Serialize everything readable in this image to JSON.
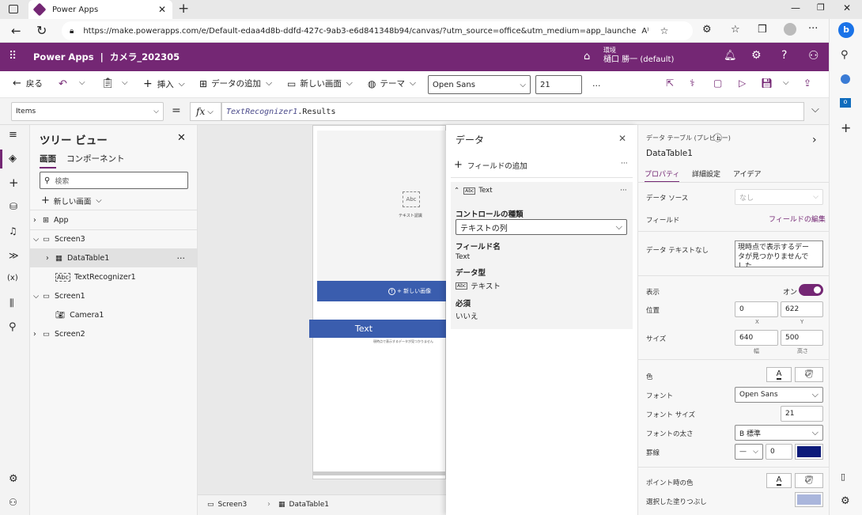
{
  "browser": {
    "tab_title": "Power Apps",
    "url": "https://make.powerapps.com/e/Default-edaa4d8b-ddfd-427c-9ab3-e6d841348b94/canvas/?utm_source=office&utm_medium=app_launcher&utm_...",
    "accent": "#1a73e8"
  },
  "header": {
    "product": "Power Apps",
    "separator": "|",
    "app_name": "カメラ_202305",
    "env_label": "環境",
    "env_name": "樋口 勝一 (default)",
    "bg": "#742774"
  },
  "toolbar": {
    "back": "戻る",
    "insert": "挿入",
    "add_data": "データの追加",
    "new_screen": "新しい画面",
    "theme": "テーマ",
    "font": "Open Sans",
    "font_size": "21",
    "more": "..."
  },
  "formula": {
    "property": "Items",
    "equals": "=",
    "fx": "fx",
    "expr_italic": "TextRecognizer1",
    "expr_rest": ".Results"
  },
  "tree": {
    "title": "ツリー ビュー",
    "tab_screens": "画面",
    "tab_components": "コンポーネント",
    "search_placeholder": "検索",
    "new_screen": "新しい画面",
    "items": [
      {
        "label": "App"
      },
      {
        "label": "Screen3"
      },
      {
        "label": "DataTable1"
      },
      {
        "label": "TextRecognizer1"
      },
      {
        "label": "Screen1"
      },
      {
        "label": "Camera1"
      },
      {
        "label": "Screen2"
      }
    ],
    "more": "···"
  },
  "canvas": {
    "recognizer_label": "テキスト認識",
    "new_image_btn": "+ 新しい画像",
    "table_header": "Text",
    "empty_text": "現時点で表示するデータが見つかりません",
    "breadcrumb_screen": "Screen3",
    "breadcrumb_control": "DataTable1"
  },
  "data_panel": {
    "title": "データ",
    "add_field": "フィールドの追加",
    "field_name_header": "Text",
    "control_type_label": "コントロールの種類",
    "control_type_value": "テキストの列",
    "field_name_label": "フィールド名",
    "field_name_value": "Text",
    "data_type_label": "データ型",
    "data_type_value": "テキスト",
    "required_label": "必須",
    "required_value": "いいえ",
    "more": "···"
  },
  "props": {
    "kind": "データ テーブル (プレビュー)",
    "name": "DataTable1",
    "tabs": [
      "プロパティ",
      "詳細設定",
      "アイデア"
    ],
    "data_source_label": "データ ソース",
    "data_source_value": "なし",
    "fields_label": "フィールド",
    "fields_link": "フィールドの編集",
    "nodata_label": "データ テキストなし",
    "nodata_value": "現時点で表示するデータが見つかりませんでした",
    "visible_label": "表示",
    "visible_value": "オン",
    "position_label": "位置",
    "x_value": "0",
    "y_value": "622",
    "x_caption": "X",
    "y_caption": "Y",
    "size_label": "サイズ",
    "width_value": "640",
    "height_value": "500",
    "width_caption": "幅",
    "height_caption": "高さ",
    "color_label": "色",
    "font_label": "フォント",
    "font_value": "Open Sans",
    "font_size_label": "フォント サイズ",
    "font_size_value": "21",
    "font_weight_label": "フォントの太さ",
    "font_weight_value": "B 標準",
    "border_label": "罫線",
    "border_width": "0",
    "hover_color_label": "ポイント時の色",
    "selected_fill_label": "選択した塗りつぶし",
    "border_color": "#0d1b7a",
    "toggle_color": "#742774"
  }
}
